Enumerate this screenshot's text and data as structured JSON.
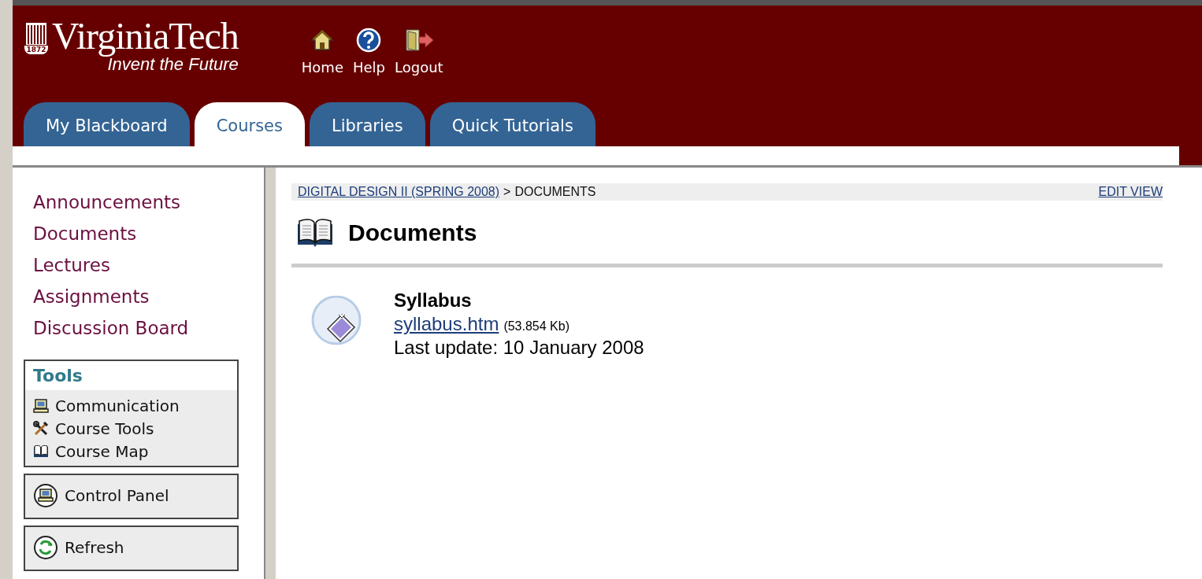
{
  "header": {
    "logo": {
      "name": "VirginiaTech",
      "year": "1872",
      "tagline": "Invent the Future"
    },
    "links": [
      {
        "label": "Home",
        "kind": "home"
      },
      {
        "label": "Help",
        "kind": "help"
      },
      {
        "label": "Logout",
        "kind": "logout"
      }
    ]
  },
  "tabs": [
    {
      "label": "My Blackboard",
      "selected": false
    },
    {
      "label": "Courses",
      "selected": true
    },
    {
      "label": "Libraries",
      "selected": false
    },
    {
      "label": "Quick Tutorials",
      "selected": false
    }
  ],
  "sidebar": {
    "items": [
      "Announcements",
      "Documents",
      "Lectures",
      "Assignments",
      "Discussion Board"
    ],
    "tools": {
      "title": "Tools",
      "items": [
        {
          "label": "Communication",
          "kind": "computer"
        },
        {
          "label": "Course Tools",
          "kind": "tools"
        },
        {
          "label": "Course Map",
          "kind": "book"
        }
      ]
    },
    "buttons": [
      {
        "label": "Control Panel",
        "kind": "control"
      },
      {
        "label": "Refresh",
        "kind": "refresh"
      }
    ]
  },
  "breadcrumb": {
    "crumbs": [
      {
        "label": "DIGITAL DESIGN II (SPRING 2008)",
        "link": true
      },
      {
        "label": "DOCUMENTS",
        "link": false
      }
    ],
    "separator": ">",
    "action": "EDIT VIEW"
  },
  "page_title": "Documents",
  "documents": [
    {
      "title": "Syllabus",
      "file": "syllabus.htm",
      "size": "(53.854 Kb)",
      "updated": "Last update: 10 January 2008"
    }
  ]
}
